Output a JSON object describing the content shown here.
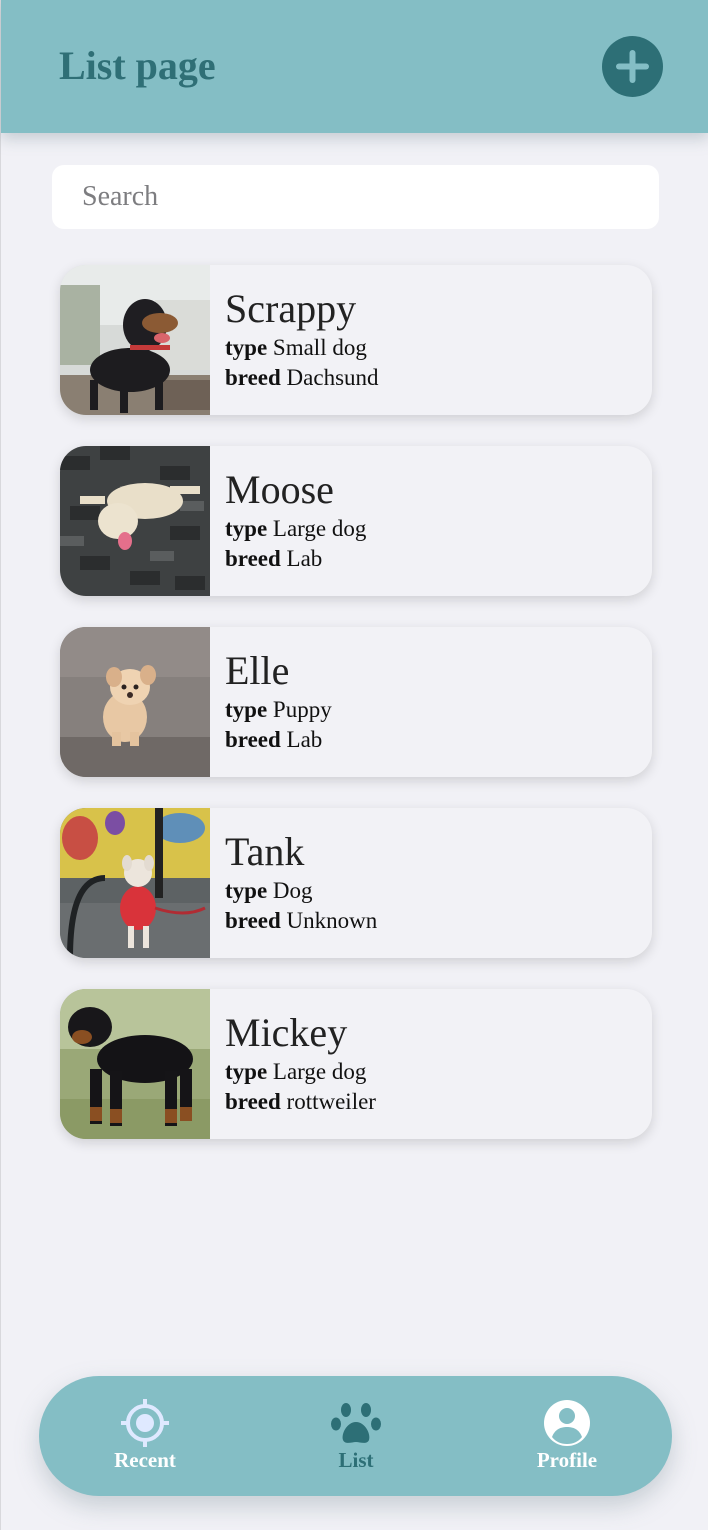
{
  "header": {
    "title": "List page",
    "add_icon": "plus-icon"
  },
  "search": {
    "placeholder": "Search",
    "value": ""
  },
  "dogs": [
    {
      "name": "Scrappy",
      "type_label": "type",
      "type": "Small dog",
      "breed_label": "breed",
      "breed": "Dachsund",
      "photo": "dachshund-photo"
    },
    {
      "name": "Moose",
      "type_label": "type",
      "type": "Large dog",
      "breed_label": "breed",
      "breed": "Lab",
      "photo": "lab-photo"
    },
    {
      "name": "Elle",
      "type_label": "type",
      "type": "Puppy",
      "breed_label": "breed",
      "breed": "Lab",
      "photo": "puppy-photo"
    },
    {
      "name": "Tank",
      "type_label": "type",
      "type": "Dog",
      "breed_label": "breed",
      "breed": "Unknown",
      "photo": "small-dog-photo"
    },
    {
      "name": "Mickey",
      "type_label": "type",
      "type": "Large dog",
      "breed_label": "breed",
      "breed": "rottweiler",
      "photo": "rottweiler-photo"
    }
  ],
  "nav": {
    "items": [
      {
        "label": "Recent",
        "icon": "target-icon",
        "active": false
      },
      {
        "label": "List",
        "icon": "paw-icon",
        "active": true
      },
      {
        "label": "Profile",
        "icon": "user-circle-icon",
        "active": false
      }
    ]
  },
  "colors": {
    "header_bg": "#84bec5",
    "accent": "#2d6f76",
    "background": "#f1f1f6",
    "card_bg": "#f2f2f6"
  }
}
